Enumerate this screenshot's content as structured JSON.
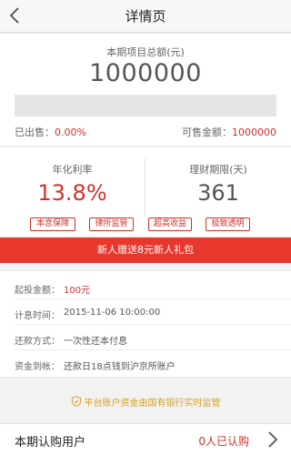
{
  "nav": {
    "title": "详情页"
  },
  "summary": {
    "total_label": "本期项目总额(元)",
    "total_value": "1000000",
    "progress_fraction": 0.0,
    "sold_label": "已出售：",
    "sold_value": "0.00%",
    "available_label": "可售金额：",
    "available_value": "1000000"
  },
  "stats": {
    "rate_label": "年化利率",
    "rate_value": "13.8%",
    "term_label": "理财期限(天)",
    "term_value": "361",
    "tags": [
      "本息保障",
      "律所监管",
      "超高收益",
      "极致透明"
    ]
  },
  "banner": {
    "text": "新人赠送8元新人礼包"
  },
  "details": {
    "rows": [
      {
        "key": "起投金额：",
        "value": "100元"
      },
      {
        "key": "计息时间：",
        "value": "2015-11-06 10:00:00"
      },
      {
        "key": "还款方式：",
        "value": "一次性还本付息"
      },
      {
        "key": "资金到帐：",
        "value": "还款日18点钱到沪京所账户"
      }
    ]
  },
  "notice": {
    "text": "平台账户资金由国有银行实时监管"
  },
  "buyers": {
    "label": "本期认购用户",
    "count": "0人已认购"
  },
  "colors": {
    "accent": "#e8372d",
    "red_text": "#d2312b",
    "gold": "#d6a128"
  },
  "icons": {
    "back": "chevron-left-icon",
    "shield": "shield-check-icon",
    "chevron": "chevron-right-icon"
  }
}
